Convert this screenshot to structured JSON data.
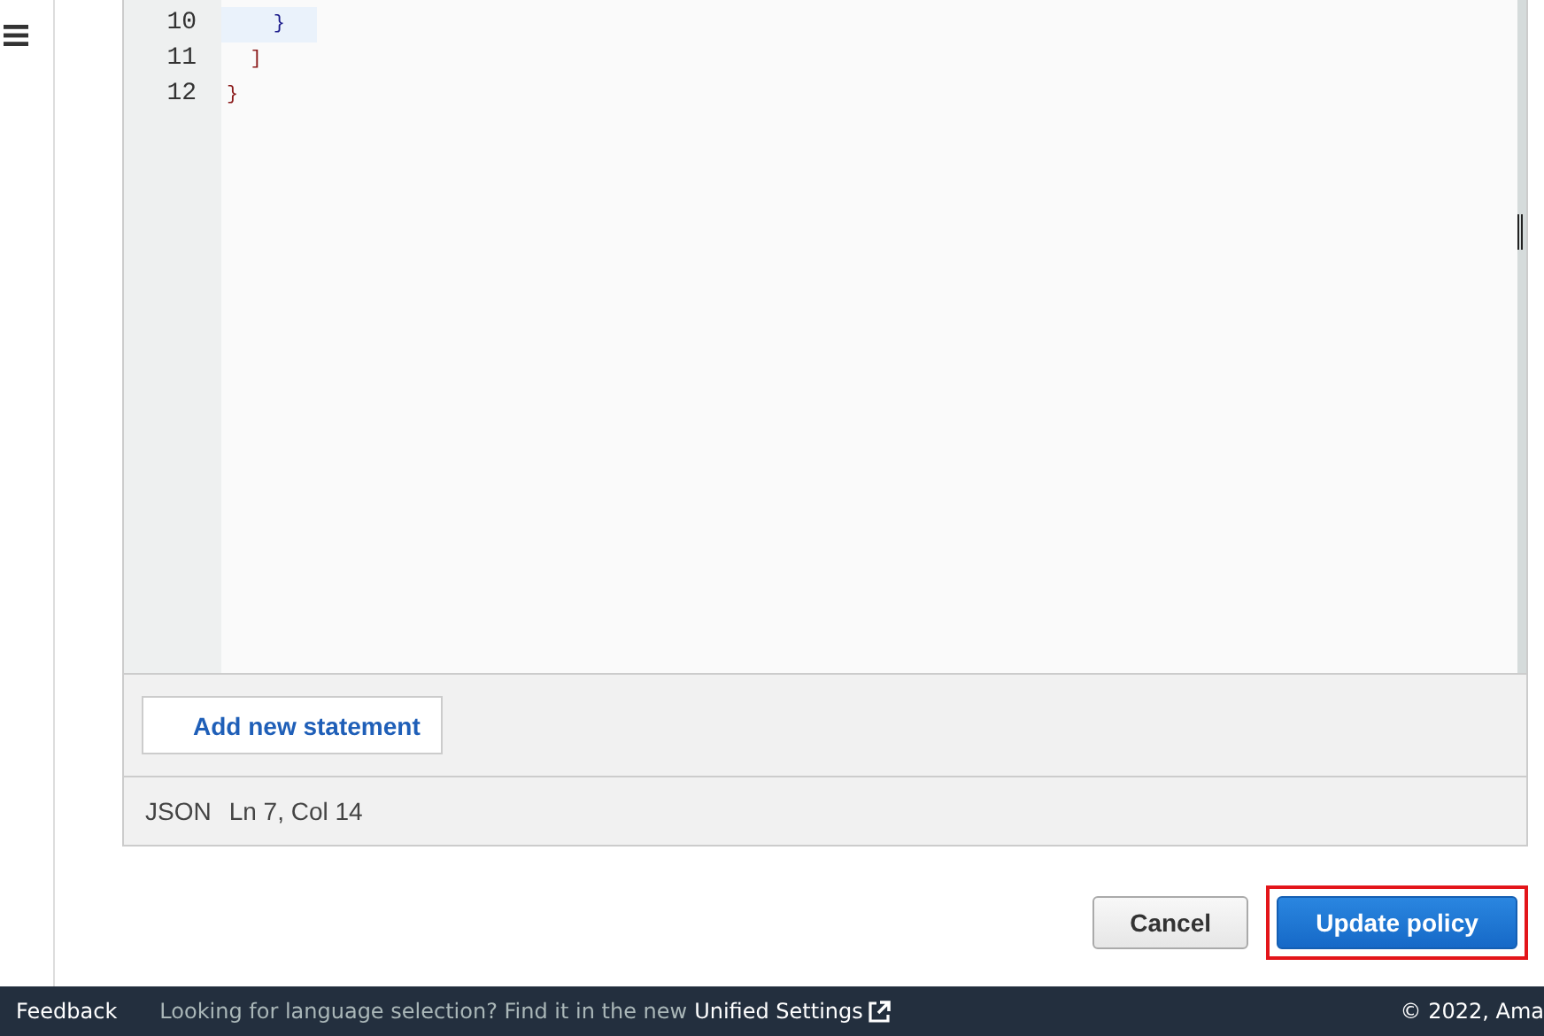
{
  "editor": {
    "lines": [
      {
        "number": "10",
        "text": "    }",
        "active": true
      },
      {
        "number": "11",
        "text": "  ]",
        "active": false
      },
      {
        "number": "12",
        "text": "}",
        "active": false
      }
    ],
    "add_statement_button": "Add new statement",
    "status": {
      "mode": "JSON",
      "position": "Ln 7, Col 14"
    }
  },
  "buttons": [
    {
      "label": "Cancel",
      "kind": "secondary",
      "highlighted": false
    },
    {
      "label": "Update policy",
      "kind": "primary",
      "highlighted": true
    }
  ],
  "footer": {
    "feedback": "Feedback",
    "notice": "Looking for language selection? Find it in the new",
    "link": "Unified Settings",
    "copyright": "© 2022, Ama"
  }
}
